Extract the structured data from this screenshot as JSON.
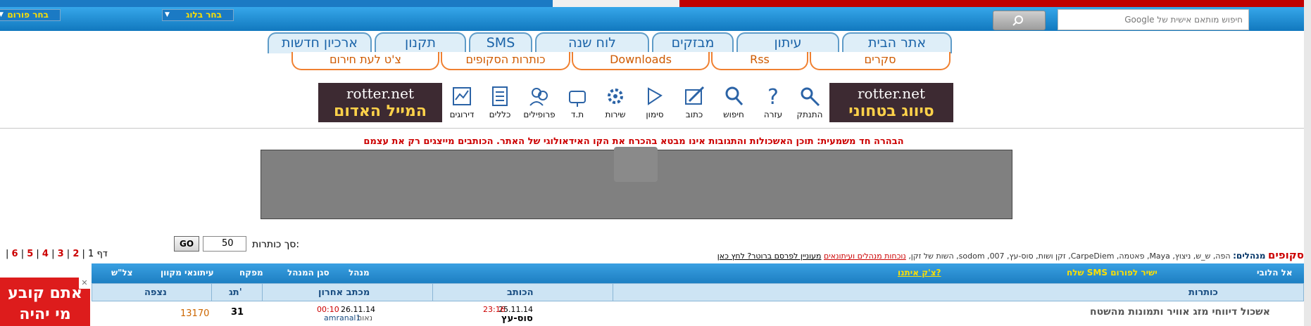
{
  "topnav": {
    "forum_select": "בחר פורום",
    "blog_select": "בחר בלוג",
    "search_placeholder": "חיפוש מותאם אישית של Google"
  },
  "tabs_top": [
    "אתר הבית",
    "עיתון",
    "מבזקים",
    "לוח שנה",
    "SMS",
    "תקנון",
    "ארכיון חדשות"
  ],
  "tabs_bottom": [
    "סקרים",
    "Rss",
    "Downloads",
    "כותרות הסקופים",
    "צ'ט לעת חירום"
  ],
  "banners": {
    "right": {
      "top": "rotter.net",
      "bottom": "סיווג בטחוני"
    },
    "left": {
      "top": "rotter.net",
      "bottom": "המייל האדום"
    }
  },
  "icons": [
    {
      "label": "התנתק",
      "icon": "key-icon"
    },
    {
      "label": "עזרה",
      "icon": "help-icon"
    },
    {
      "label": "חיפוש",
      "icon": "search-icon"
    },
    {
      "label": "כתוב",
      "icon": "write-icon"
    },
    {
      "label": "סימון",
      "icon": "mark-icon"
    },
    {
      "label": "שירות",
      "icon": "gear-icon"
    },
    {
      "label": "ת.ד",
      "icon": "mailbox-icon"
    },
    {
      "label": "פרופילים",
      "icon": "profiles-icon"
    },
    {
      "label": "כללים",
      "icon": "rules-icon"
    },
    {
      "label": "דירוגים",
      "icon": "ratings-icon"
    }
  ],
  "disclaimer": "הבהרה חד משמעית: תוכן האשכולות והתגובות אינו מבטא בהכרח את הקו האידאולוגי של האתר. הכותבים מייצגים רק את עצמם",
  "pager": {
    "prefix": "דף 1 |",
    "pages": [
      "2",
      "3",
      "4",
      "5",
      "6"
    ]
  },
  "count": {
    "label": "סך כותרות:",
    "value": "50",
    "go": "GO"
  },
  "forums": {
    "title": "סקופים",
    "managers_label": "מנהלים:",
    "managers": "הפה, ש_ש, ניצוץ, Maya, פאטמה, CarpeDiem, זקן ושות, סוס-עץ, 007, sodom, השות של זקן,",
    "link1": "נוכחות מנהלים ועיתונאים",
    "link2": "מעוניין לפרסם ברוטר? לחץ כאן"
  },
  "toolbar": {
    "to_board": "אל הלובי",
    "send_sms": "שלח SMS ישיר לפורום",
    "chat": "צ'ק איתנו?",
    "manager": "מנהל",
    "deputy": "סגן המנהל",
    "supervisor": "מפקח",
    "reporter": "עיתונאי מקוון",
    "idf": "צל\"ש"
  },
  "table": {
    "headers": {
      "titles": "כותרות",
      "author": "הכותב",
      "last": "מכתב אחרון",
      "replies": "תג'",
      "views": "נצפה"
    },
    "rows": [
      {
        "title": "אשכול דיווחי מזג אוויר ותמונות מהשטח",
        "author_date": "25.11.14",
        "author_time": "23:16",
        "author": "סוס-עץ",
        "last_date": "26.11.14",
        "last_time": "00:10",
        "last_by_prefix": "נאות",
        "last_by": "amranal1",
        "replies": "31",
        "views": "13170"
      }
    ]
  },
  "side_ad": {
    "line1": "אתם קובע",
    "line2": "מי יהיה"
  }
}
